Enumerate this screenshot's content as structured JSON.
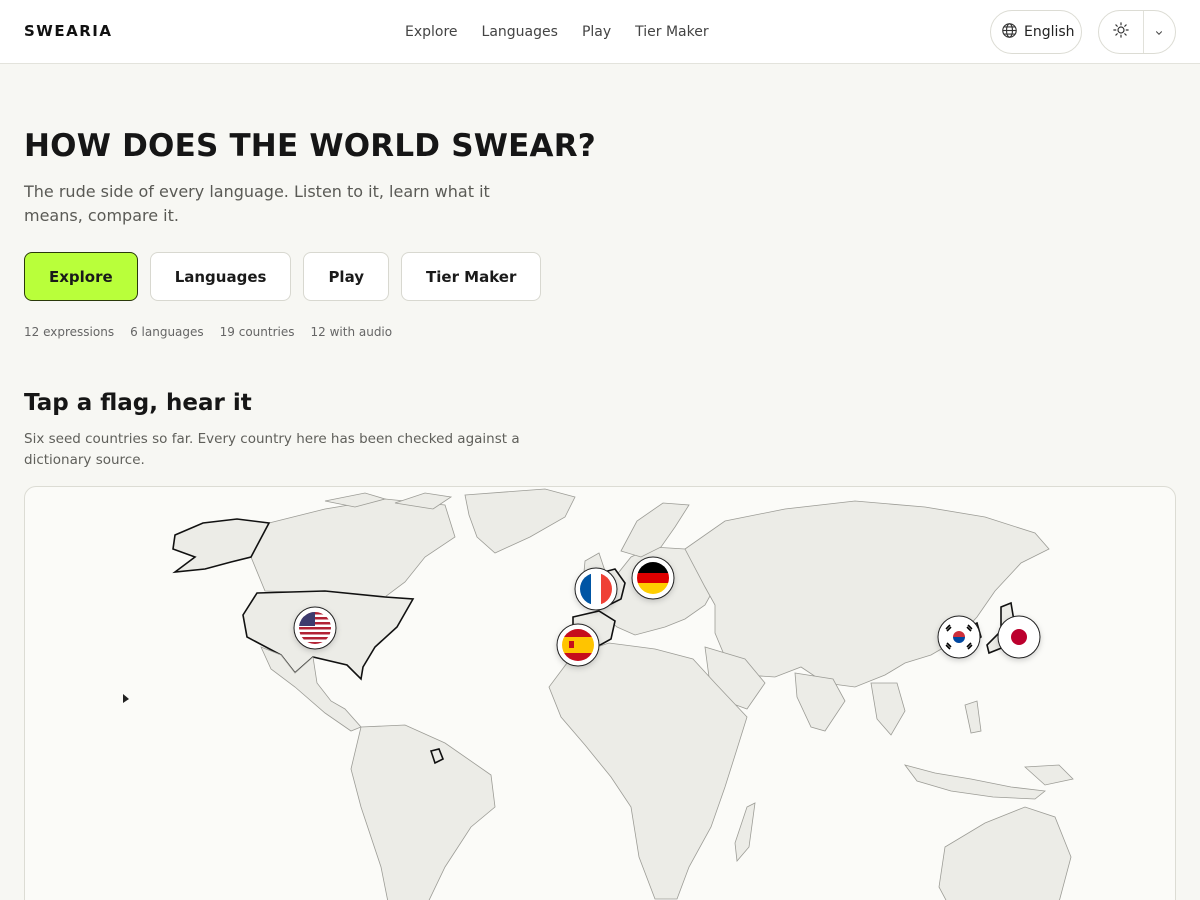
{
  "header": {
    "logo": "SWEARIA",
    "nav": [
      "Explore",
      "Languages",
      "Play",
      "Tier Maker"
    ],
    "language_label": "English",
    "icons": {
      "language": "globe-icon",
      "theme": "sun-icon",
      "dropdown": "chevron-down-icon"
    }
  },
  "hero": {
    "title": "HOW DOES THE WORLD SWEAR?",
    "subtitle": "The rude side of every language. Listen to it, learn what it means, compare it.",
    "buttons": [
      "Explore",
      "Languages",
      "Play",
      "Tier Maker"
    ],
    "stats": [
      "12 expressions",
      "6 languages",
      "19 countries",
      "12 with audio"
    ]
  },
  "map_section": {
    "title": "Tap a flag, hear it",
    "subtitle": "Six seed countries so far. Every country here has been checked against a dictionary source.",
    "flags": [
      "us-flag",
      "fr-flag",
      "de-flag",
      "es-flag",
      "kr-flag",
      "jp-flag"
    ]
  },
  "colors": {
    "accent": "#b9ff3a",
    "background": "#f7f7f3",
    "land": "#ecece7"
  }
}
